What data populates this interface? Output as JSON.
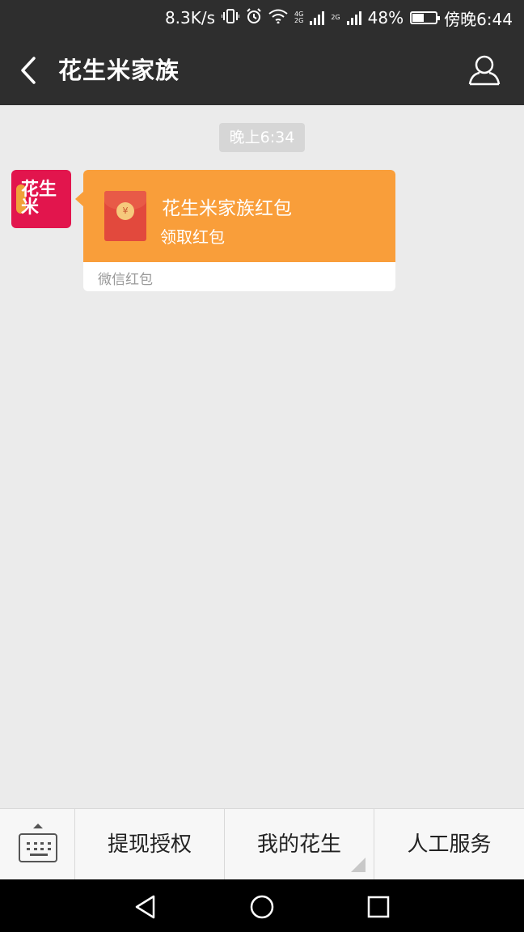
{
  "status_bar": {
    "speed": "8.3K/s",
    "network_1": "4G",
    "network_1b": "2G",
    "network_2": "2G",
    "battery_text": "48%",
    "battery_level": 0.48,
    "time": "傍晚6:44",
    "icons": [
      "vibrate-icon",
      "alarm-icon",
      "wifi-icon",
      "signal-icon",
      "battery-icon"
    ]
  },
  "header": {
    "title": "花生米家族",
    "back_icon": "chevron-left-icon",
    "profile_icon": "person-icon"
  },
  "chat": {
    "timestamp": "晚上6:34",
    "message": {
      "avatar_text_1": "花生",
      "avatar_text_2": "米",
      "redpacket_title": "花生米家族红包",
      "redpacket_action": "领取红包",
      "redpacket_footer": "微信红包",
      "coin_symbol": "¥"
    }
  },
  "menu": {
    "keyboard_icon": "keyboard-icon",
    "items": [
      {
        "label": "提现授权"
      },
      {
        "label": "我的花生"
      },
      {
        "label": "人工服务"
      }
    ]
  },
  "nav_bar": {
    "icons": [
      "back-triangle-icon",
      "home-circle-icon",
      "recents-square-icon"
    ]
  },
  "colors": {
    "header_bg": "#2e2e2e",
    "chat_bg": "#ebebeb",
    "redpacket_orange": "#f99e3a",
    "avatar_red": "#e2154d"
  }
}
